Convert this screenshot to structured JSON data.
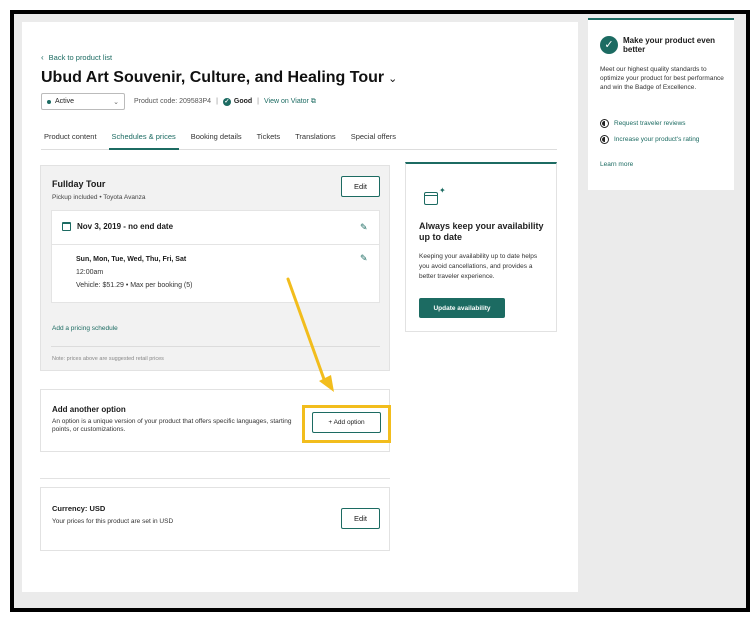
{
  "header": {
    "back_label": "Back to product list",
    "title": "Ubud Art Souvenir, Culture, and Healing Tour",
    "status": "Active",
    "product_code_label": "Product code: 209583P4",
    "quality": "Good",
    "view_link": "View on Viator"
  },
  "tabs": [
    {
      "label": "Product content"
    },
    {
      "label": "Schedules & prices"
    },
    {
      "label": "Booking details"
    },
    {
      "label": "Tickets"
    },
    {
      "label": "Translations"
    },
    {
      "label": "Special offers"
    }
  ],
  "option": {
    "title": "Fullday Tour",
    "subtitle": "Pickup included • Toyota Avanza",
    "edit_label": "Edit",
    "date_range": "Nov 3, 2019 - no end date",
    "days": "Sun, Mon, Tue, Wed, Thu, Fri, Sat",
    "time": "12:00am",
    "price": "Vehicle: $51.29  •  Max per booking (5)",
    "add_pricing": "Add a pricing schedule",
    "note": "Note: prices above are suggested retail prices"
  },
  "add_option": {
    "title": "Add another option",
    "description": "An option is a unique version of your product that offers specific languages, starting points, or customizations.",
    "button": "+ Add option"
  },
  "currency": {
    "title": "Currency: USD",
    "description": "Your prices for this product are set in USD",
    "edit_label": "Edit"
  },
  "availability": {
    "title": "Always keep your availability up to date",
    "description": "Keeping your availability up to date helps you avoid cancellations, and provides a better traveler experience.",
    "button": "Update availability"
  },
  "sidebar": {
    "title": "Make your product even better",
    "description": "Meet our highest quality standards to optimize your product for best performance and win the Badge of Excellence.",
    "links": [
      {
        "label": "Request traveler reviews"
      },
      {
        "label": "Increase your product's rating"
      }
    ],
    "learn_more": "Learn more"
  },
  "colors": {
    "accent": "#1c6b62",
    "highlight": "#f2bd1d",
    "background": "#ebebeb"
  }
}
